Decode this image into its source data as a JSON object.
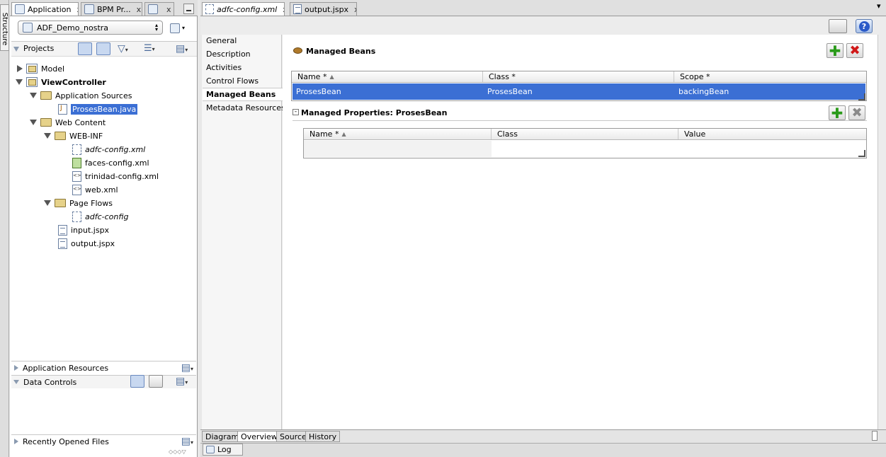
{
  "left_tabs": [
    "Application",
    "BPM Pr...",
    ""
  ],
  "side_strip": {
    "structure_label": "Structure"
  },
  "app_selector": {
    "value": "ADF_Demo_nostra"
  },
  "projects_panel": {
    "title": "Projects"
  },
  "tree": {
    "model": "Model",
    "view_controller": "ViewController",
    "application_sources": "Application Sources",
    "proses_bean_java": "ProsesBean.java",
    "web_content": "Web Content",
    "web_inf": "WEB-INF",
    "adfc_config_xml": "adfc-config.xml",
    "faces_config_xml": "faces-config.xml",
    "trinidad_config_xml": "trinidad-config.xml",
    "web_xml": "web.xml",
    "page_flows": "Page Flows",
    "adfc_config": "adfc-config",
    "input_jspx": "input.jspx",
    "output_jspx": "output.jspx"
  },
  "accordions": {
    "application_resources": "Application Resources",
    "data_controls": "Data Controls",
    "recently_opened": "Recently Opened Files"
  },
  "editor_tabs": [
    "adfc-config.xml",
    "output.jspx"
  ],
  "overview_nav": [
    "General",
    "Description",
    "Activities",
    "Control Flows",
    "Managed Beans",
    "Metadata Resources"
  ],
  "overview_nav_selected": "Managed Beans",
  "managed_beans": {
    "title": "Managed Beans",
    "columns": [
      "Name *",
      "Class *",
      "Scope *"
    ],
    "rows": [
      {
        "name": "ProsesBean",
        "class": "ProsesBean",
        "scope": "backingBean"
      }
    ]
  },
  "managed_properties": {
    "title": "Managed Properties: ProsesBean",
    "columns": [
      "Name *",
      "Class",
      "Value"
    ]
  },
  "bottom_tabs": [
    "Diagram",
    "Overview",
    "Source",
    "History"
  ],
  "bottom_tabs_selected": "Overview",
  "log_tab": "Log",
  "colors": {
    "selection": "#3b6fd4",
    "add_green": "#2a9a1a",
    "delete_red": "#d01818"
  }
}
